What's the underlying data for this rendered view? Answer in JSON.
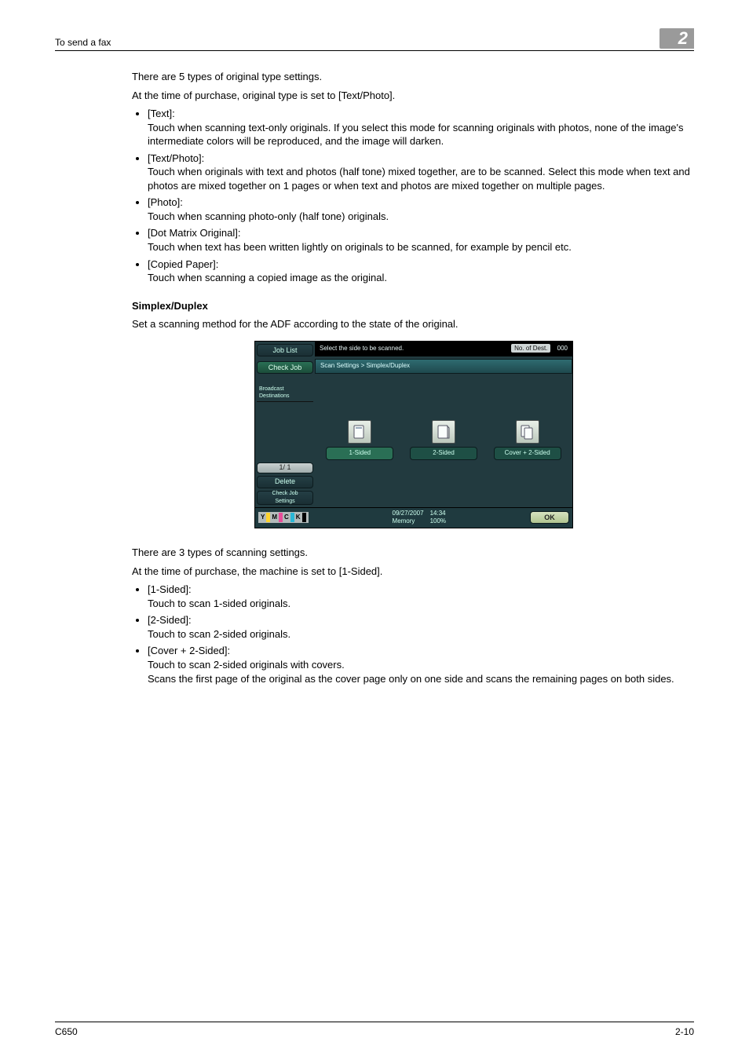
{
  "header": {
    "running_head": "To send a fax",
    "chapter_no": "2"
  },
  "intro1": "There are 5 types of original type settings.",
  "intro2": "At the time of purchase, original type is set to [Text/Photo].",
  "orig_types": [
    {
      "name": "[Text]:",
      "desc": "Touch when scanning text-only originals. If you select this mode for scanning originals with photos, none of the image's intermediate colors will be reproduced, and the image will darken."
    },
    {
      "name": "[Text/Photo]:",
      "desc": "Touch when originals with text and photos (half tone) mixed together, are to be scanned. Select this mode when text and photos are mixed together on 1 pages or when text and photos are mixed together on multiple pages."
    },
    {
      "name": "[Photo]:",
      "desc": "Touch when scanning photo-only (half tone) originals."
    },
    {
      "name": "[Dot Matrix Original]:",
      "desc": "Touch when text has been written lightly on originals to be scanned, for example by pencil etc."
    },
    {
      "name": "[Copied Paper]:",
      "desc": "Touch when scanning a copied image as the original."
    }
  ],
  "section_h": "Simplex/Duplex",
  "section_p": "Set a scanning method for the ADF according to the state of the original.",
  "panel": {
    "job_list": "Job List",
    "check_job": "Check Job",
    "broadcast": "Broadcast\nDestinations",
    "page_indicator": "1/  1",
    "delete": "Delete",
    "check_settings": "Check Job\nSettings",
    "message": "Select the side to be scanned.",
    "dest_label": "No. of\nDest.",
    "dest_count": "000",
    "crumb": "Scan Settings > Simplex/Duplex",
    "options": [
      {
        "label": "1-Sided",
        "selected": true
      },
      {
        "label": "2-Sided",
        "selected": false
      },
      {
        "label": "Cover + 2-Sided",
        "selected": false
      }
    ],
    "ok": "OK",
    "date": "09/27/2007",
    "time": "14:34",
    "mem_label": "Memory",
    "mem_val": "100%",
    "toner_letters": [
      "Y",
      "M",
      "C",
      "K"
    ]
  },
  "intro3": "There are 3 types of scanning settings.",
  "intro4": "At the time of purchase, the machine is set to [1-Sided].",
  "scan_types": [
    {
      "name": "[1-Sided]:",
      "desc": "Touch to scan 1-sided originals."
    },
    {
      "name": "[2-Sided]:",
      "desc": "Touch to scan 2-sided originals."
    },
    {
      "name": "[Cover + 2-Sided]:",
      "desc": "Touch to scan 2-sided originals with covers.\nScans the first page of the original as the cover page only on one side and scans the remaining pages on both sides."
    }
  ],
  "footer": {
    "left": "C650",
    "right": "2-10"
  }
}
